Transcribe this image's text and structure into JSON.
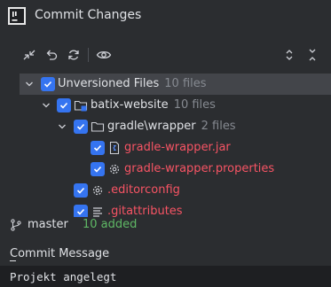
{
  "window": {
    "title": "Commit Changes"
  },
  "tree": {
    "group": {
      "label": "Unversioned Files",
      "count": "10 files"
    },
    "project": {
      "label": "batix-website",
      "count": "10 files"
    },
    "folder": {
      "label": "gradle\\wrapper",
      "count": "2 files"
    },
    "files": [
      {
        "label": "gradle-wrapper.jar",
        "icon": "jar-file-icon"
      },
      {
        "label": "gradle-wrapper.properties",
        "icon": "properties-gear-icon"
      }
    ],
    "root_files": [
      {
        "label": ".editorconfig",
        "icon": "gear-file-icon"
      },
      {
        "label": ".gitattributes",
        "icon": "text-file-icon"
      }
    ]
  },
  "status": {
    "branch": "master",
    "added": "10 added",
    "added_color": "#5fb865"
  },
  "commit": {
    "label": "Commit Message",
    "message": "Projekt angelegt"
  },
  "colors": {
    "accent": "#3574f0",
    "unversioned": "#f75464",
    "selected_row": "#43454a"
  }
}
